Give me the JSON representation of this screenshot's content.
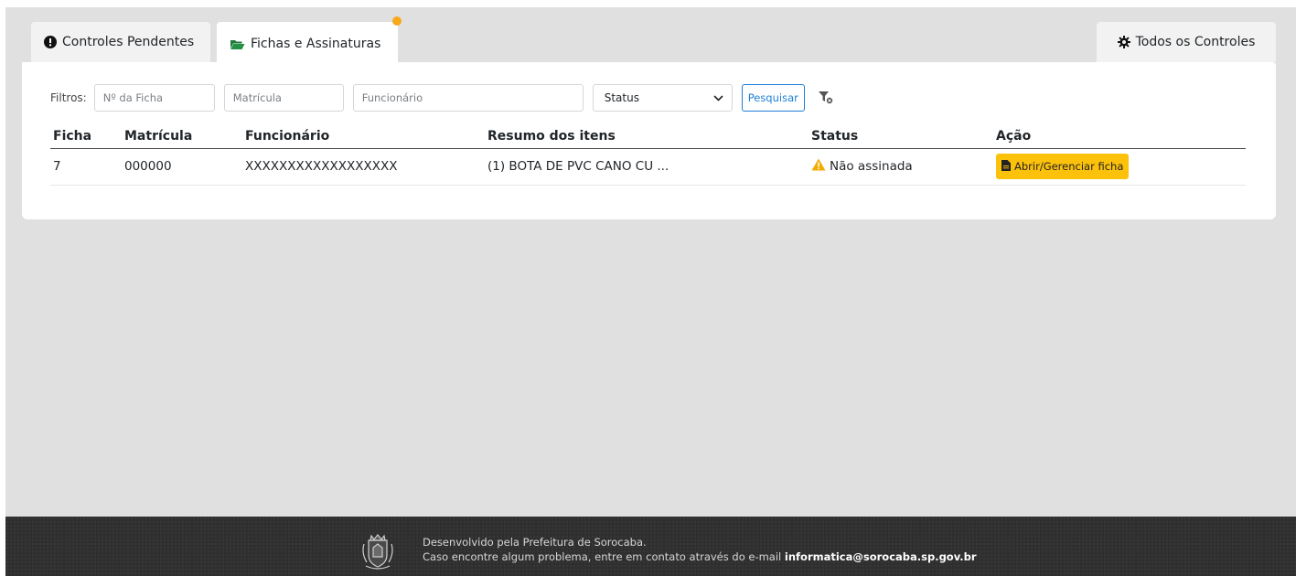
{
  "tabs": {
    "pending": {
      "label": "Controles Pendentes",
      "icon": "exclamation-circle-icon"
    },
    "forms": {
      "label": "Fichas e Assinaturas",
      "icon": "folder-open-icon",
      "notification_color": "#f7a81b"
    },
    "all": {
      "label": "Todos os Controles",
      "icon": "gear-icon"
    }
  },
  "filters": {
    "label": "Filtros:",
    "ficha_placeholder": "Nº da Ficha",
    "matricula_placeholder": "Matrícula",
    "funcionario_placeholder": "Funcionário",
    "status_selected": "Status",
    "search_label": "Pesquisar",
    "clear_icon": "filter-clear-icon"
  },
  "table": {
    "headers": {
      "ficha": "Ficha",
      "matricula": "Matrícula",
      "funcionario": "Funcionário",
      "resumo": "Resumo dos itens",
      "status": "Status",
      "acao": "Ação"
    },
    "rows": [
      {
        "ficha": "7",
        "matricula": "000000",
        "funcionario": "XXXXXXXXXXXXXXXXXX",
        "resumo": "(1) BOTA DE PVC CANO CU ...",
        "status": "Não assinada",
        "status_icon": "warning-icon",
        "action_label": "Abrir/Gerenciar ficha",
        "action_icon": "file-icon"
      }
    ]
  },
  "footer": {
    "line1": "Desenvolvido pela Prefeitura de Sorocaba.",
    "line2_prefix": "Caso encontre algum problema, entre em contato através do e-mail",
    "email": "informatica@sorocaba.sp.gov.br",
    "crest_icon": "coat-of-arms-icon"
  },
  "colors": {
    "background": "#e0e0e0",
    "accent_blue": "#1e7fd6",
    "action_yellow": "#fcc10b",
    "warning": "#f0ad00",
    "footer": "#2f2f2f"
  }
}
